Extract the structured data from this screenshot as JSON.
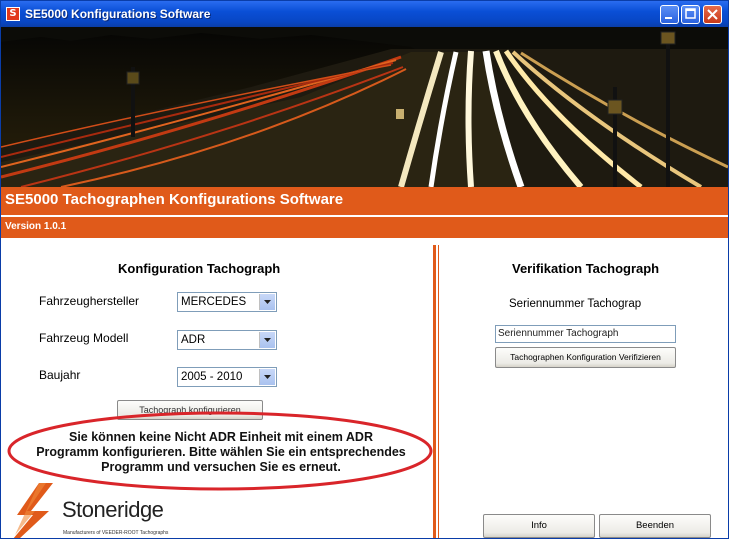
{
  "window": {
    "title": "SE5000 Konfigurations Software",
    "app_icon_letter": "S"
  },
  "header": {
    "title": "SE5000 Tachographen Konfigurations Software",
    "version": "Version  1.0.1"
  },
  "config": {
    "heading": "Konfiguration Tachograph",
    "manufacturer_label": "Fahrzeughersteller",
    "manufacturer_value": "MERCEDES",
    "model_label": "Fahrzeug Modell",
    "model_value": "ADR",
    "year_label": "Baujahr",
    "year_value": "2005 - 2010",
    "configure_button": "Tachograph konfigurieren"
  },
  "message": {
    "line1": "Sie können keine Nicht ADR Einheit mit einem ADR",
    "line2": "Programm konfigurieren. Bitte wählen Sie ein entsprechendes",
    "line3": "Programm und versuchen Sie es erneut."
  },
  "verification": {
    "heading": "Verifikation Tachograph",
    "serial_label": "Seriennummer Tachograp",
    "serial_value": "Seriennummer Tachograph",
    "verify_button": "Tachographen Konfiguration Verifizieren"
  },
  "footer": {
    "info_button": "Info",
    "exit_button": "Beenden",
    "logo_text": "Stoneridge",
    "logo_subtext": "Manufacturers of VEEDER-ROOT Tachographs"
  },
  "colors": {
    "accent": "#e05a1a",
    "highlight_ellipse": "#d9252a"
  }
}
